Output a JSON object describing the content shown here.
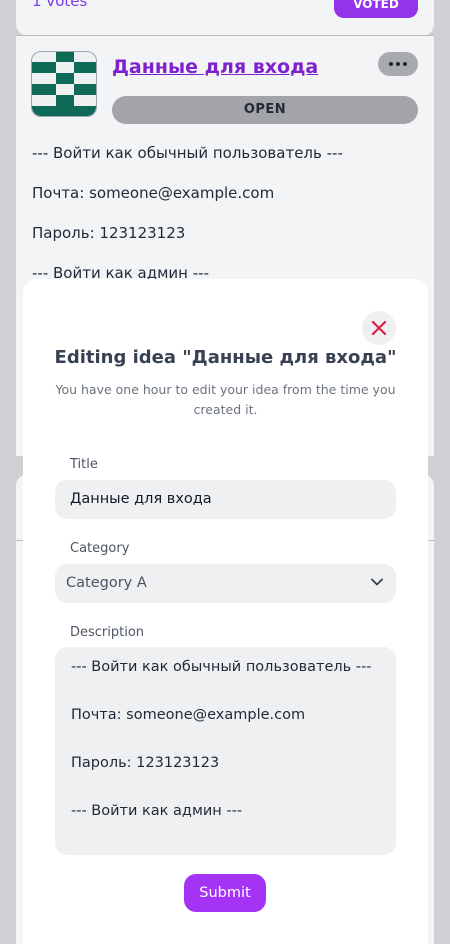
{
  "colors": {
    "accent": "#9333ea",
    "title_link": "#7e22ce",
    "close_x": "#e11d48",
    "logo_green": "#0f6b57"
  },
  "background_card": {
    "votes_text": "1 votes",
    "voted_label": "VOTED",
    "logo_icon": "checkered-logo-icon",
    "title": "Данные для входа",
    "menu_icon": "more-dots-icon",
    "status": "OPEN",
    "lines": [
      "--- Войти как обычный пользователь ---",
      "Почта: someone@example.com",
      "Пароль: 123123123",
      "--- Войти как админ ---"
    ]
  },
  "modal": {
    "close_icon": "close-x-icon",
    "title": "Editing idea \"Данные для входа\"",
    "subtitle": "You have one hour to edit your idea from the time you created it.",
    "fields": {
      "title_label": "Title",
      "title_value": "Данные для входа",
      "category_label": "Category",
      "category_value": "Category A",
      "category_icon": "chevron-down-icon",
      "description_label": "Description",
      "description_lines": [
        "--- Войти как обычный пользователь ---",
        "Почта: someone@example.com",
        "Пароль: 123123123",
        "--- Войти как админ ---"
      ]
    },
    "submit_label": "Submit"
  }
}
